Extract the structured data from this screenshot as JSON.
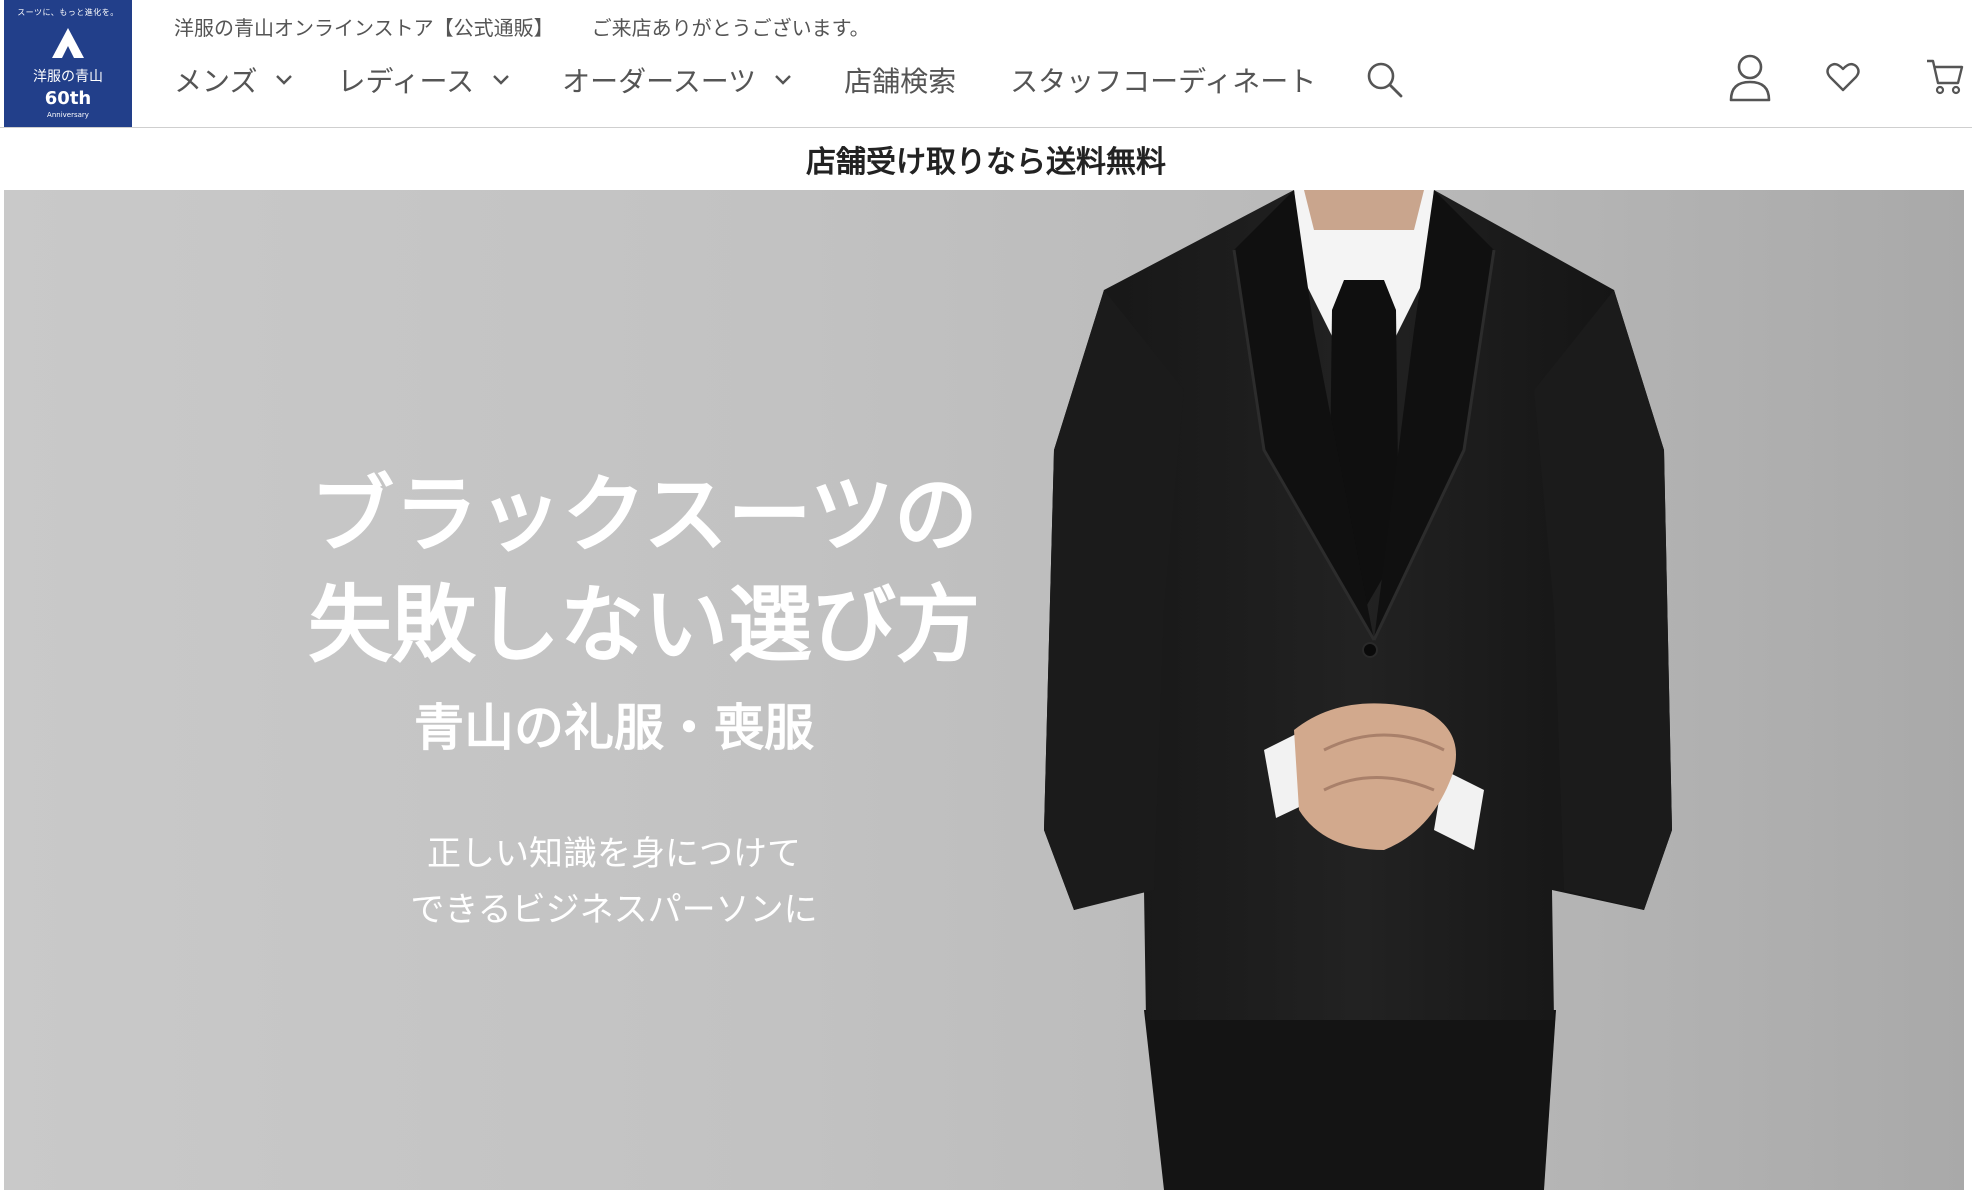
{
  "header": {
    "logo": {
      "tagline": "スーツに、もっと進化を。",
      "brand": "洋服の青山",
      "years": "60th",
      "anniversary": "Anniversary"
    },
    "tagline": {
      "site_name": "洋服の青山オンラインストア【公式通販】",
      "welcome": "ご来店ありがとうございます。"
    },
    "nav": {
      "mens": "メンズ",
      "ladies": "レディース",
      "order_suits": "オーダースーツ",
      "store_search": "店舗検索",
      "staff_coordinate": "スタッフコーディネート"
    },
    "icons": {
      "search": "search-icon",
      "account": "account-icon",
      "favorites": "heart-icon",
      "cart": "cart-icon",
      "dropdown": "chevron-down-icon"
    }
  },
  "promo_banner": {
    "text": "店舗受け取りなら送料無料"
  },
  "hero": {
    "title_line1": "ブラックスーツの",
    "title_line2": "失敗しない選び方",
    "subtitle": "青山の礼服・喪服",
    "desc_line1": "正しい知識を身につけて",
    "desc_line2": "できるビジネスパーソンに"
  },
  "colors": {
    "brand_blue": "#223f8a",
    "hero_bg": "#c3c3c3",
    "nav_text": "#555555"
  }
}
